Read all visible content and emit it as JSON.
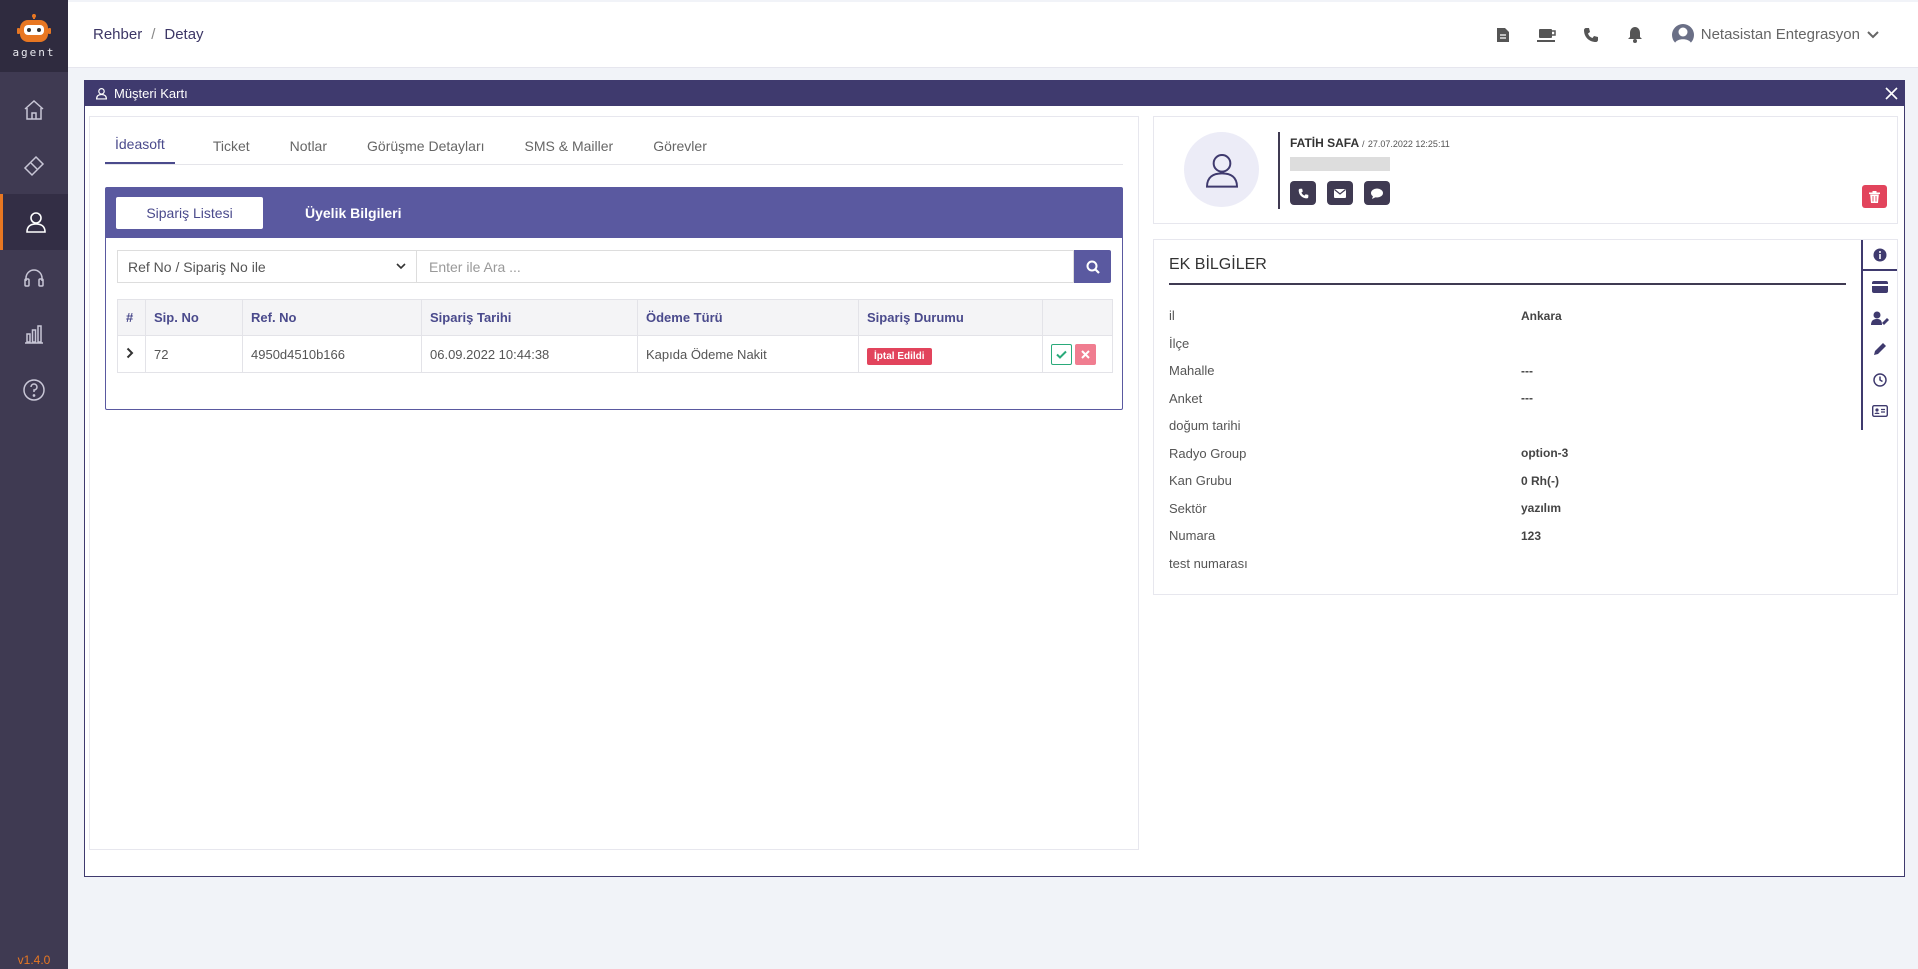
{
  "sidebar": {
    "logo_text": "agent",
    "items": [
      {
        "icon": "home-icon"
      },
      {
        "icon": "ticket-icon"
      },
      {
        "icon": "user-icon",
        "active": true
      },
      {
        "icon": "headset-icon"
      },
      {
        "icon": "chart-icon"
      },
      {
        "icon": "help-icon"
      }
    ],
    "version": "v1.4.0"
  },
  "topbar": {
    "breadcrumb": [
      "Rehber",
      "Detay"
    ],
    "breadcrumb_sep": "/",
    "icons": [
      "document-icon",
      "coffee-icon",
      "phone-icon",
      "bell-icon"
    ],
    "user_name": "Netasistan Entegrasyon"
  },
  "modal": {
    "title": "Müşteri Kartı",
    "tabs": [
      "İdeasoft",
      "Ticket",
      "Notlar",
      "Görüşme Detayları",
      "SMS & Mailler",
      "Görevler"
    ],
    "active_tab": "İdeasoft",
    "subtabs": [
      "Sipariş Listesi",
      "Üyelik Bilgileri"
    ],
    "search": {
      "select_value": "Ref No / Sipariş No ile",
      "placeholder": "Enter ile Ara ..."
    },
    "table": {
      "headers": [
        "#",
        "Sip. No",
        "Ref. No",
        "Sipariş Tarihi",
        "Ödeme Türü",
        "Sipariş Durumu",
        ""
      ],
      "rows": [
        {
          "sip_no": "72",
          "ref_no": "4950d4510b166",
          "tarih": "06.09.2022 10:44:38",
          "odeme": "Kapıda Ödeme Nakit",
          "durum": "İptal Edildi"
        }
      ]
    }
  },
  "profile": {
    "name": "FATİH SAFA",
    "sep": "/",
    "date": "27.07.2022 12:25:11"
  },
  "extra": {
    "title": "EK BİLGİLER",
    "rows": [
      {
        "key": "il",
        "value": "Ankara"
      },
      {
        "key": "İlçe",
        "value": ""
      },
      {
        "key": "Mahalle",
        "value": "---"
      },
      {
        "key": "Anket",
        "value": "---"
      },
      {
        "key": "doğum tarihi",
        "value": ""
      },
      {
        "key": "Radyo Group",
        "value": "option-3"
      },
      {
        "key": "Kan Grubu",
        "value": "0 Rh(-)"
      },
      {
        "key": "Sektör",
        "value": "yazılım"
      },
      {
        "key": "Numara",
        "value": "123"
      },
      {
        "key": "test numarası",
        "value": ""
      }
    ],
    "side_icons": [
      "info-icon",
      "card-icon",
      "user-edit-icon",
      "pencil-icon",
      "clock-icon",
      "id-card-icon"
    ]
  },
  "colors": {
    "sidebar": "#3f3a52",
    "accent": "#5a59a0",
    "orange": "#e87722",
    "danger": "#e2445c"
  }
}
